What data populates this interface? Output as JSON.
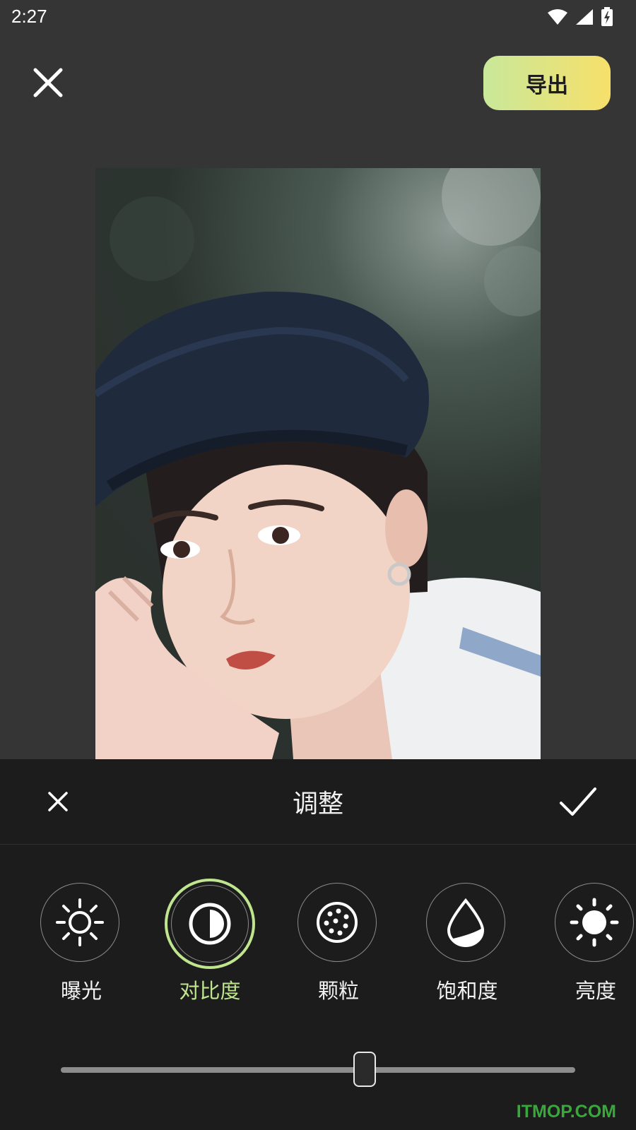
{
  "status_bar": {
    "time": "2:27",
    "icons": [
      "wifi-icon",
      "signal-icon",
      "battery-charging-icon"
    ]
  },
  "top_bar": {
    "close_icon": "close-icon",
    "export_label": "导出"
  },
  "photo": {
    "description_icon": "portrait-photo"
  },
  "panel": {
    "title": "调整",
    "cancel_icon": "close-icon",
    "confirm_icon": "checkmark-icon",
    "tools": [
      {
        "label": "曝光",
        "icon": "sun-outline-icon",
        "active": false
      },
      {
        "label": "对比度",
        "icon": "contrast-icon",
        "active": true
      },
      {
        "label": "颗粒",
        "icon": "grain-icon",
        "active": false
      },
      {
        "label": "饱和度",
        "icon": "droplet-icon",
        "active": false
      },
      {
        "label": "亮度",
        "icon": "sun-filled-icon",
        "active": false
      }
    ],
    "slider": {
      "value": 0.59
    }
  },
  "watermark": "ITMOP.COM",
  "colors": {
    "accent": "#bfe58f",
    "export_gradient_start": "#c9e89a",
    "export_gradient_end": "#f7e06a",
    "panel_bg": "#1c1c1c",
    "app_bg": "#353535",
    "watermark": "#38a83a"
  }
}
